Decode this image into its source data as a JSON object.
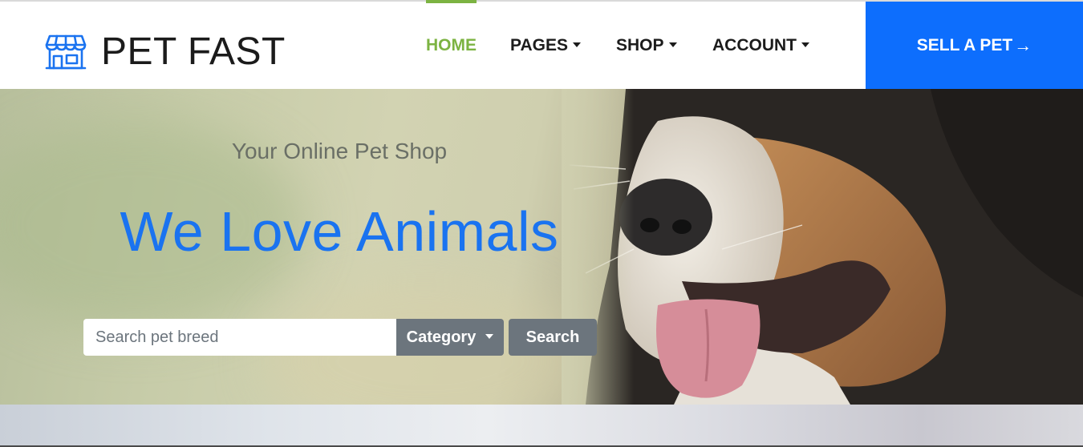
{
  "brand": {
    "name": "PET FAST",
    "icon": "storefront-icon"
  },
  "nav": {
    "items": [
      {
        "label": "HOME",
        "active": true,
        "dropdown": false
      },
      {
        "label": "PAGES",
        "active": false,
        "dropdown": true
      },
      {
        "label": "SHOP",
        "active": false,
        "dropdown": true
      },
      {
        "label": "ACCOUNT",
        "active": false,
        "dropdown": true
      }
    ],
    "cta": {
      "label": "SELL A PET",
      "arrow": "→"
    }
  },
  "hero": {
    "tagline": "Your Online Pet Shop",
    "headline": "We Love Animals",
    "search": {
      "placeholder": "Search pet breed",
      "value": "",
      "category_label": "Category",
      "button_label": "Search"
    }
  },
  "colors": {
    "accent_green": "#7cb342",
    "primary_blue": "#0d6efd",
    "headline_blue": "#1a73f0",
    "button_gray": "#6c757d"
  }
}
